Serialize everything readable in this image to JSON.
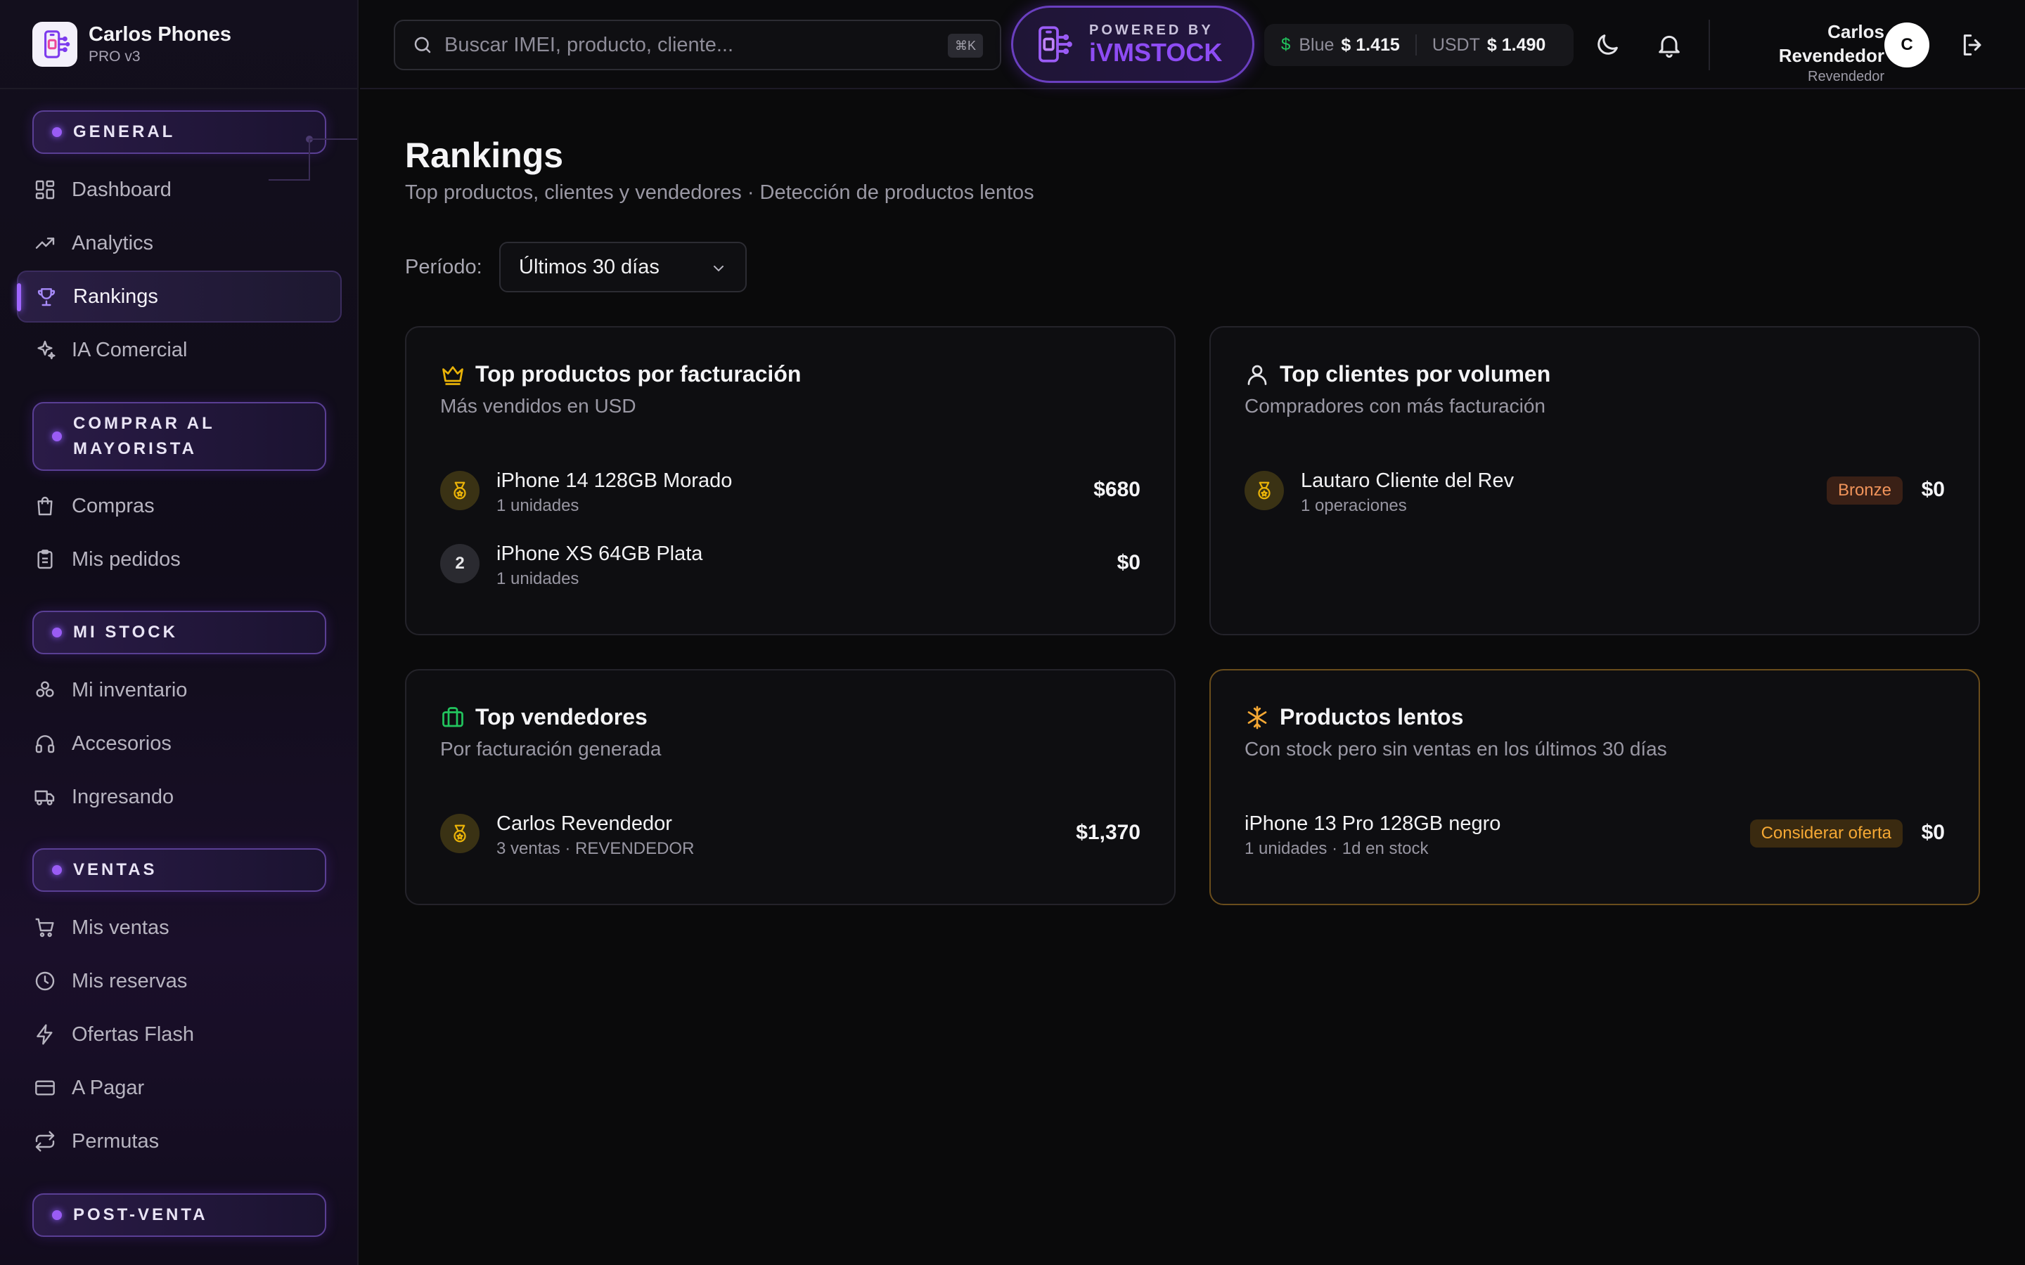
{
  "brand": {
    "name": "Carlos Phones",
    "version": "PRO v3"
  },
  "search": {
    "placeholder": "Buscar IMEI, producto, cliente...",
    "shortcut": "⌘K"
  },
  "powered": {
    "line1": "POWERED BY",
    "line2": "iVMSTOCK"
  },
  "rates": {
    "blue_label": "Blue",
    "blue_value": "$ 1.415",
    "usdt_label": "USDT",
    "usdt_value": "$ 1.490"
  },
  "user": {
    "name": "Carlos Revendedor",
    "role": "Revendedor",
    "initial": "C"
  },
  "sidebar": {
    "sections": [
      {
        "label": "GENERAL",
        "line2": ""
      },
      {
        "label": "COMPRAR AL",
        "line2": "MAYORISTA"
      },
      {
        "label": "MI STOCK",
        "line2": ""
      },
      {
        "label": "VENTAS",
        "line2": ""
      },
      {
        "label": "POST-VENTA",
        "line2": ""
      }
    ],
    "items": [
      {
        "label": "Dashboard",
        "icon": "dashboard-icon"
      },
      {
        "label": "Analytics",
        "icon": "trending-up-icon"
      },
      {
        "label": "Rankings",
        "icon": "trophy-icon",
        "active": true
      },
      {
        "label": "IA Comercial",
        "icon": "sparkles-icon"
      },
      {
        "label": "Compras",
        "icon": "shopping-bag-icon"
      },
      {
        "label": "Mis pedidos",
        "icon": "clipboard-icon"
      },
      {
        "label": "Mi inventario",
        "icon": "boxes-icon"
      },
      {
        "label": "Accesorios",
        "icon": "headphones-icon"
      },
      {
        "label": "Ingresando",
        "icon": "truck-icon"
      },
      {
        "label": "Mis ventas",
        "icon": "cart-icon"
      },
      {
        "label": "Mis reservas",
        "icon": "clock-icon"
      },
      {
        "label": "Ofertas Flash",
        "icon": "zap-icon"
      },
      {
        "label": "A Pagar",
        "icon": "credit-card-icon"
      },
      {
        "label": "Permutas",
        "icon": "repeat-icon"
      }
    ]
  },
  "page": {
    "title": "Rankings",
    "subtitle": "Top productos, clientes y vendedores · Detección de productos lentos",
    "period_label": "Período:",
    "period_value": "Últimos 30 días"
  },
  "cards": {
    "top_products": {
      "title": "Top productos por facturación",
      "subtitle": "Más vendidos en USD",
      "rows": [
        {
          "rank": "1",
          "name": "iPhone 14 128GB Morado",
          "meta": "1 unidades",
          "amount": "$680"
        },
        {
          "rank": "2",
          "name": "iPhone XS 64GB Plata",
          "meta": "1 unidades",
          "amount": "$0"
        }
      ]
    },
    "top_clients": {
      "title": "Top clientes por volumen",
      "subtitle": "Compradores con más facturación",
      "rows": [
        {
          "rank": "1",
          "name": "Lautaro Cliente del Rev",
          "meta": "1 operaciones",
          "badge": "Bronze",
          "amount": "$0"
        }
      ]
    },
    "top_sellers": {
      "title": "Top vendedores",
      "subtitle": "Por facturación generada",
      "rows": [
        {
          "rank": "1",
          "name": "Carlos Revendedor",
          "meta": "3 ventas · REVENDEDOR",
          "amount": "$1,370"
        }
      ]
    },
    "slow_products": {
      "title": "Productos lentos",
      "subtitle": "Con stock pero sin ventas en los últimos 30 días",
      "rows": [
        {
          "name": "iPhone 13 Pro 128GB negro",
          "meta": "1 unidades · 1d en stock",
          "badge": "Considerar oferta",
          "amount": "$0"
        }
      ]
    }
  },
  "colors": {
    "accent": "#8b5cf6",
    "gold": "#eab308",
    "warn": "#f5a834",
    "green": "#22c55e"
  }
}
